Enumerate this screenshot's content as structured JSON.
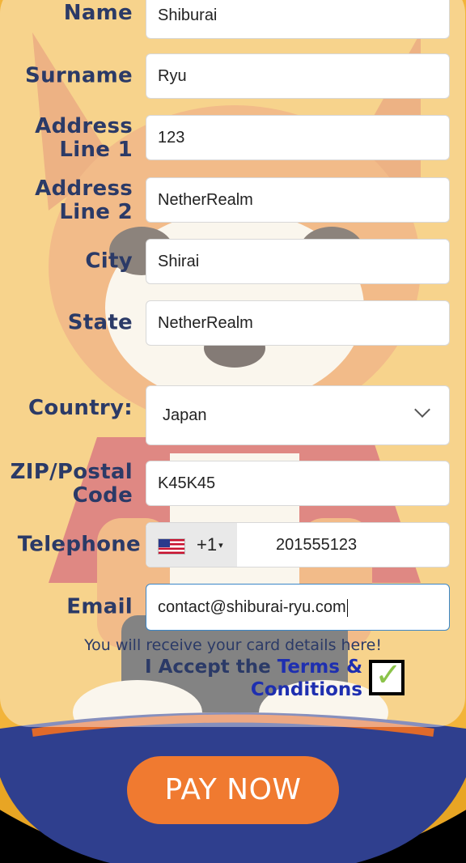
{
  "form": {
    "name": {
      "label": "Name",
      "value": "Shiburai"
    },
    "surname": {
      "label": "Surname",
      "value": "Ryu"
    },
    "address1": {
      "label_line1": "Address",
      "label_line2": "Line 1",
      "value": "123"
    },
    "address2": {
      "label_line1": "Address",
      "label_line2": "Line 2",
      "value": "NetherRealm"
    },
    "city": {
      "label": "City",
      "value": "Shirai"
    },
    "state": {
      "label": "State",
      "value": "NetherRealm"
    },
    "country": {
      "label": "Country:",
      "selected": "Japan"
    },
    "zip": {
      "label_line1": "ZIP/Postal",
      "label_line2": "Code",
      "value": "K45K45"
    },
    "telephone": {
      "label": "Telephone",
      "dial_code": "+1",
      "dial_arrow": "▾",
      "value": "201555123",
      "flag_icon": "us-flag-icon"
    },
    "email": {
      "label": "Email",
      "value": "contact@shiburai-ryu.com"
    },
    "email_note": "You will receive your card details here!",
    "terms": {
      "prefix": "I Accept the ",
      "link_line1": "Terms &",
      "link_line2": "Conditions",
      "checked": true,
      "check_glyph": "✓"
    }
  },
  "pay_button": {
    "label": "PAY NOW"
  },
  "colors": {
    "accent": "#f07a30",
    "label": "#2b3a67",
    "link": "#1e2fb0",
    "check": "#8bc34a"
  }
}
